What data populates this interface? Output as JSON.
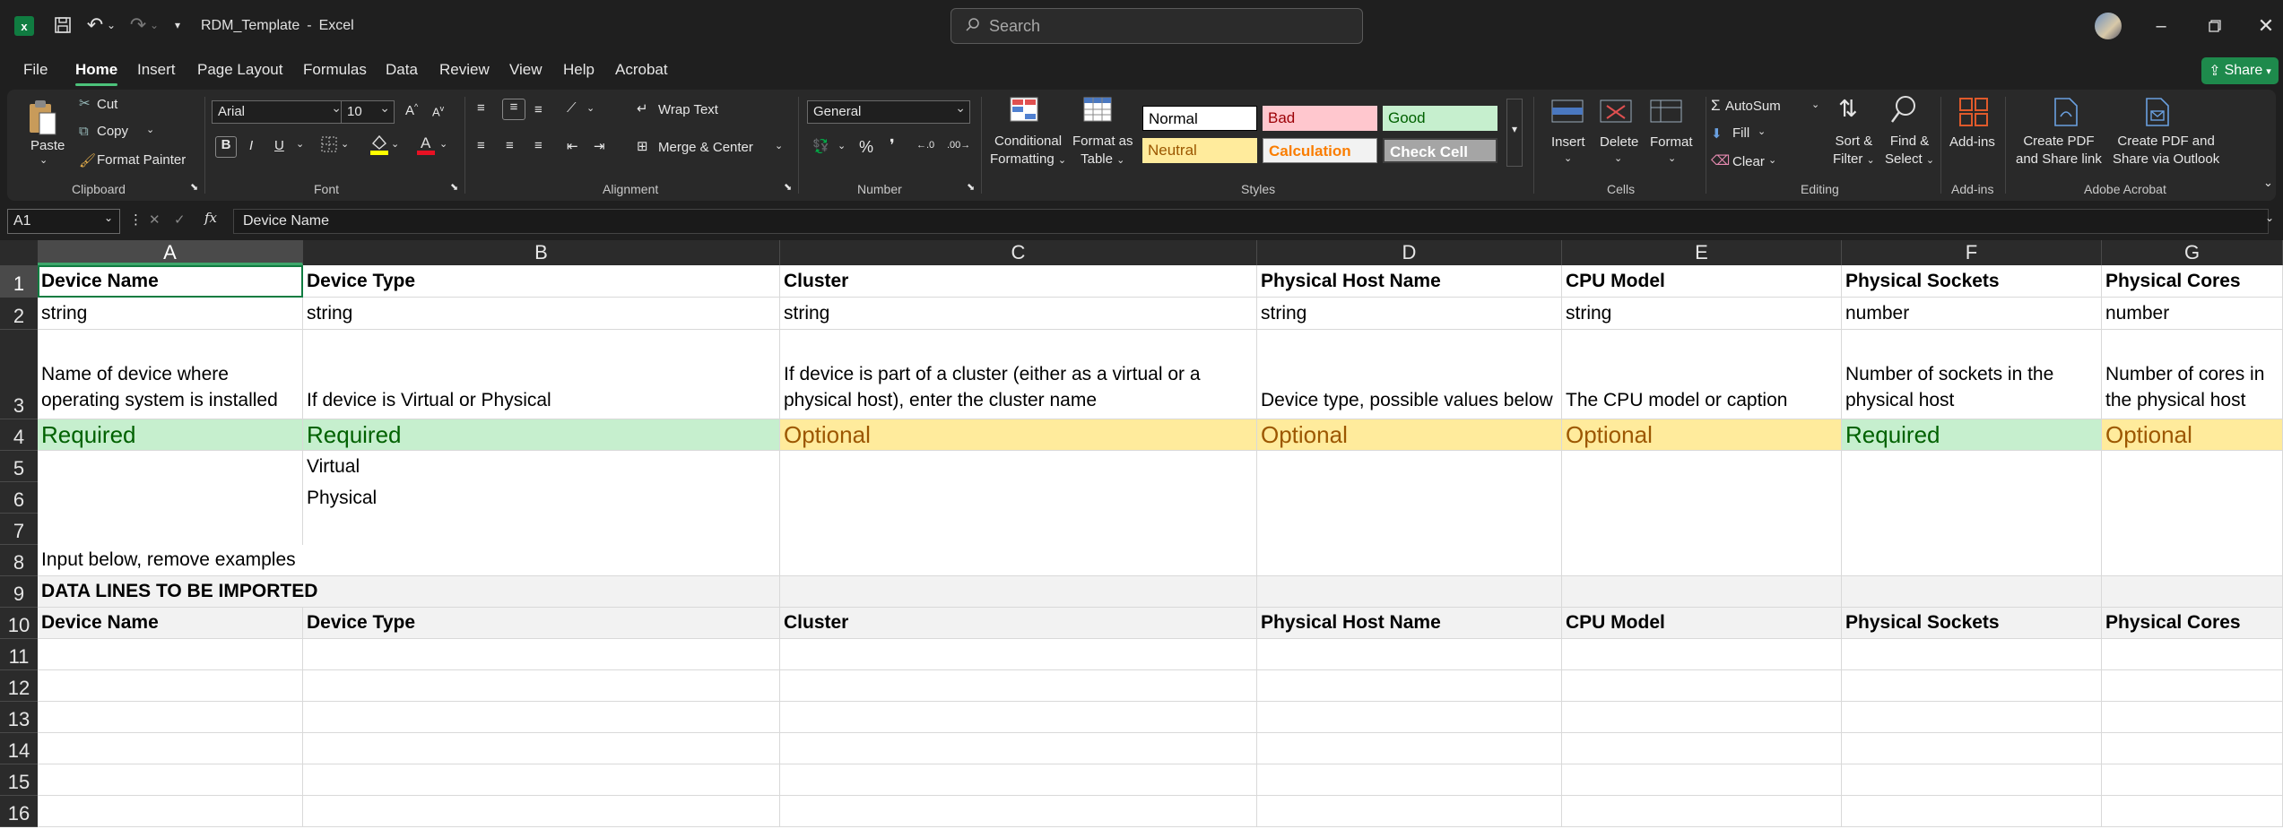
{
  "titlebar": {
    "doc_name": "RDM_Template",
    "separator": "-",
    "app_name": "Excel",
    "search_placeholder": "Search"
  },
  "menu": {
    "tabs": [
      "File",
      "Home",
      "Insert",
      "Page Layout",
      "Formulas",
      "Data",
      "Review",
      "View",
      "Help",
      "Acrobat"
    ],
    "active_tab": "Home",
    "share_label": "Share"
  },
  "ribbon": {
    "clipboard": {
      "paste": "Paste",
      "cut": "Cut",
      "copy": "Copy",
      "format_painter": "Format Painter",
      "group": "Clipboard"
    },
    "font": {
      "name": "Arial",
      "size": "10",
      "group": "Font"
    },
    "alignment": {
      "wrap_text": "Wrap Text",
      "merge_center": "Merge & Center",
      "group": "Alignment"
    },
    "number": {
      "format": "General",
      "group": "Number"
    },
    "styles": {
      "conditional_formatting": [
        "Conditional",
        "Formatting"
      ],
      "format_as_table": [
        "Format as",
        "Table"
      ],
      "cells": [
        {
          "label": "Normal",
          "bg": "#ffffff",
          "fg": "#000000",
          "border": "#000000"
        },
        {
          "label": "Bad",
          "bg": "#ffc7ce",
          "fg": "#9c0006",
          "border": "#ffc7ce"
        },
        {
          "label": "Good",
          "bg": "#c6efce",
          "fg": "#006100",
          "border": "#c6efce"
        },
        {
          "label": "Neutral",
          "bg": "#ffeb9c",
          "fg": "#9c5700",
          "border": "#ffeb9c"
        },
        {
          "label": "Calculation",
          "bg": "#f2f2f2",
          "fg": "#fa7d00",
          "border": "#7f7f7f"
        },
        {
          "label": "Check Cell",
          "bg": "#a5a5a5",
          "fg": "#ffffff",
          "border": "#3f3f3f"
        }
      ],
      "group": "Styles"
    },
    "cells": {
      "insert": "Insert",
      "delete": "Delete",
      "format": "Format",
      "group": "Cells"
    },
    "editing": {
      "autosum": "AutoSum",
      "fill": "Fill",
      "clear": "Clear",
      "sort_filter": [
        "Sort &",
        "Filter"
      ],
      "find_select": [
        "Find &",
        "Select"
      ],
      "group": "Editing"
    },
    "addins": {
      "label": "Add-ins",
      "group": "Add-ins"
    },
    "acrobat": {
      "create_pdf_share": [
        "Create PDF",
        "and Share link"
      ],
      "create_pdf_outlook": [
        "Create PDF and",
        "Share via Outlook"
      ],
      "group": "Adobe Acrobat"
    }
  },
  "formula_bar": {
    "name_box": "A1",
    "fx": "fx",
    "content": "Device Name"
  },
  "sheet": {
    "columns": [
      "A",
      "B",
      "C",
      "D",
      "E",
      "F",
      "G"
    ],
    "rows": [
      "1",
      "2",
      "3",
      "4",
      "5",
      "6",
      "7",
      "8",
      "9",
      "10",
      "11",
      "12",
      "13",
      "14",
      "15",
      "16"
    ],
    "header_row": [
      "Device Name",
      "Device Type",
      "Cluster",
      "Physical Host Name",
      "CPU Model",
      "Physical Sockets",
      "Physical Cores"
    ],
    "type_row": [
      "string",
      "string",
      "string",
      "string",
      "string",
      "number",
      "number"
    ],
    "description_row": [
      "Name of device where operating system is installed",
      "If device is Virtual or Physical",
      "If device is part of a cluster (either as a virtual or a physical host), enter the cluster name",
      "Device type, possible values below",
      "The CPU model or caption",
      "Number of sockets in the physical host",
      "Number of cores in the physical host"
    ],
    "requirement_row": [
      "Required",
      "Required",
      "Optional",
      "Optional",
      "Optional",
      "Required",
      "Optional"
    ],
    "values_b5": "Virtual",
    "values_b6": "Physical",
    "instruction_a8": "Input below, remove examples",
    "section_a9": "DATA LINES TO BE IMPORTED",
    "import_header_row": [
      "Device Name",
      "Device Type",
      "Cluster",
      "Physical Host Name",
      "CPU Model",
      "Physical Sockets",
      "Physical Cores"
    ]
  }
}
